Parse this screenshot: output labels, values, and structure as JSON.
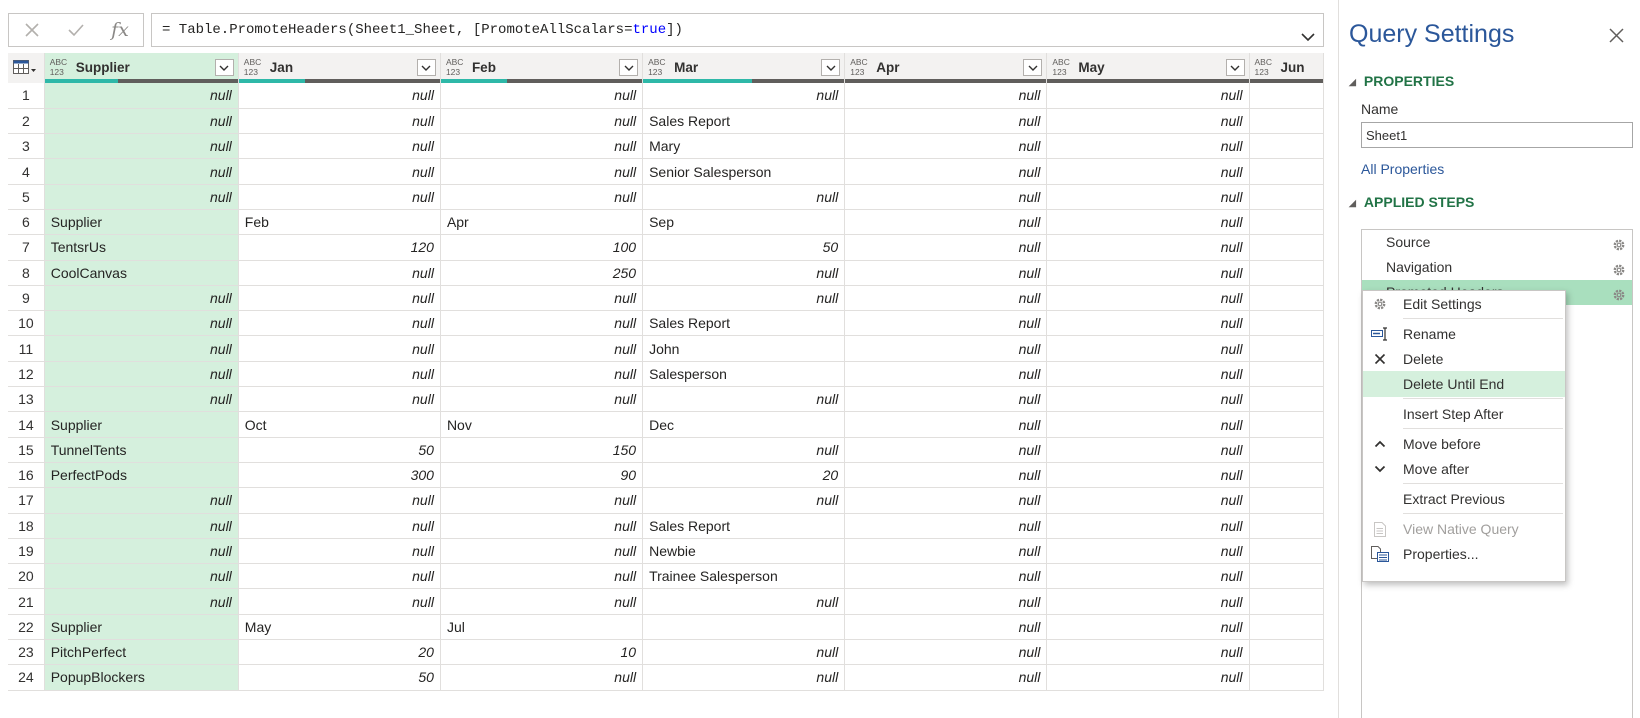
{
  "formula": {
    "prefix": "= Table.PromoteHeaders(Sheet1_Sheet, [PromoteAllScalars=",
    "keyword": "true",
    "suffix": "])",
    "fx_label": "fx"
  },
  "grid": {
    "type_badge_top": "ABC",
    "type_badge_bottom": "123",
    "columns": [
      {
        "name": "Supplier",
        "valid_fraction": 0.38
      },
      {
        "name": "Jan",
        "valid_fraction": 0.33
      },
      {
        "name": "Feb",
        "valid_fraction": 0.33
      },
      {
        "name": "Mar",
        "valid_fraction": 0.54
      },
      {
        "name": "Apr",
        "valid_fraction": 0
      },
      {
        "name": "May",
        "valid_fraction": 0
      },
      {
        "name": "Jun",
        "valid_fraction": 0
      }
    ],
    "rows": [
      {
        "n": "1",
        "cells": [
          "null",
          "null",
          "null",
          "null",
          "null",
          "null",
          ""
        ]
      },
      {
        "n": "2",
        "cells": [
          "null",
          "null",
          "null",
          "Sales Report",
          "null",
          "null",
          ""
        ]
      },
      {
        "n": "3",
        "cells": [
          "null",
          "null",
          "null",
          "Mary",
          "null",
          "null",
          ""
        ]
      },
      {
        "n": "4",
        "cells": [
          "null",
          "null",
          "null",
          "Senior Salesperson",
          "null",
          "null",
          ""
        ]
      },
      {
        "n": "5",
        "cells": [
          "null",
          "null",
          "null",
          "null",
          "null",
          "null",
          ""
        ]
      },
      {
        "n": "6",
        "cells": [
          "Supplier",
          "Feb",
          "Apr",
          "Sep",
          "null",
          "null",
          ""
        ]
      },
      {
        "n": "7",
        "cells": [
          "TentsrUs",
          "120",
          "100",
          "50",
          "null",
          "null",
          ""
        ]
      },
      {
        "n": "8",
        "cells": [
          "CoolCanvas",
          "null",
          "250",
          "null",
          "null",
          "null",
          ""
        ]
      },
      {
        "n": "9",
        "cells": [
          "null",
          "null",
          "null",
          "null",
          "null",
          "null",
          ""
        ]
      },
      {
        "n": "10",
        "cells": [
          "null",
          "null",
          "null",
          "Sales Report",
          "null",
          "null",
          ""
        ]
      },
      {
        "n": "11",
        "cells": [
          "null",
          "null",
          "null",
          "John",
          "null",
          "null",
          ""
        ]
      },
      {
        "n": "12",
        "cells": [
          "null",
          "null",
          "null",
          "Salesperson",
          "null",
          "null",
          ""
        ]
      },
      {
        "n": "13",
        "cells": [
          "null",
          "null",
          "null",
          "null",
          "null",
          "null",
          ""
        ]
      },
      {
        "n": "14",
        "cells": [
          "Supplier",
          "Oct",
          "Nov",
          "Dec",
          "null",
          "null",
          ""
        ]
      },
      {
        "n": "15",
        "cells": [
          "TunnelTents",
          "50",
          "150",
          "null",
          "null",
          "null",
          ""
        ]
      },
      {
        "n": "16",
        "cells": [
          "PerfectPods",
          "300",
          "90",
          "20",
          "null",
          "null",
          ""
        ]
      },
      {
        "n": "17",
        "cells": [
          "null",
          "null",
          "null",
          "null",
          "null",
          "null",
          ""
        ]
      },
      {
        "n": "18",
        "cells": [
          "null",
          "null",
          "null",
          "Sales Report",
          "null",
          "null",
          ""
        ]
      },
      {
        "n": "19",
        "cells": [
          "null",
          "null",
          "null",
          "Newbie",
          "null",
          "null",
          ""
        ]
      },
      {
        "n": "20",
        "cells": [
          "null",
          "null",
          "null",
          "Trainee Salesperson",
          "null",
          "null",
          ""
        ]
      },
      {
        "n": "21",
        "cells": [
          "null",
          "null",
          "null",
          "null",
          "null",
          "null",
          ""
        ]
      },
      {
        "n": "22",
        "cells": [
          "Supplier",
          "May",
          "Jul",
          "",
          "null",
          "null",
          ""
        ]
      },
      {
        "n": "23",
        "cells": [
          "PitchPerfect",
          "20",
          "10",
          "null",
          "null",
          "null",
          ""
        ]
      },
      {
        "n": "24",
        "cells": [
          "PopupBlockers",
          "50",
          "null",
          "null",
          "null",
          "null",
          ""
        ]
      }
    ]
  },
  "panel": {
    "title": "Query Settings",
    "properties_header": "PROPERTIES",
    "name_label": "Name",
    "name_value": "Sheet1",
    "all_properties": "All Properties",
    "applied_steps_header": "APPLIED STEPS",
    "steps": [
      "Source",
      "Navigation",
      "Promoted Headers"
    ]
  },
  "context_menu": {
    "items": [
      {
        "label": "Edit Settings",
        "icon": "gear-icon"
      },
      {
        "label": "Rename",
        "icon": "rename-icon"
      },
      {
        "label": "Delete",
        "icon": "delete-x-icon"
      },
      {
        "label": "Delete Until End",
        "icon": ""
      },
      {
        "label": "Insert Step After",
        "icon": ""
      },
      {
        "label": "Move before",
        "icon": "chevron-up-icon"
      },
      {
        "label": "Move after",
        "icon": "chevron-down-icon"
      },
      {
        "label": "Extract Previous",
        "icon": ""
      },
      {
        "label": "View Native Query",
        "icon": "document-icon"
      },
      {
        "label": "Properties...",
        "icon": "properties-icon"
      }
    ],
    "highlighted": "Delete Until End",
    "disabled": "View Native Query"
  },
  "colors": {
    "accent_green": "#217346",
    "selected_column": "#d5f0dd",
    "active_step": "#a9dfbe",
    "quality_valid": "#2eb8a8",
    "link_blue": "#2b579a"
  }
}
